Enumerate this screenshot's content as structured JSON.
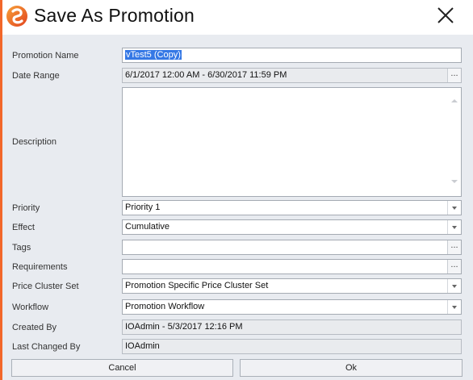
{
  "dialog": {
    "title": "Save As Promotion",
    "accent_color": "#f2672a"
  },
  "fields": {
    "promotion_name": {
      "label": "Promotion Name",
      "value": "vTest5 (Copy)"
    },
    "date_range": {
      "label": "Date Range",
      "value": "6/1/2017 12:00 AM - 6/30/2017 11:59 PM",
      "button": "..."
    },
    "description": {
      "label": "Description",
      "value": ""
    },
    "priority": {
      "label": "Priority",
      "value": "Priority 1"
    },
    "effect": {
      "label": "Effect",
      "value": "Cumulative"
    },
    "tags": {
      "label": "Tags",
      "value": "",
      "button": "..."
    },
    "requirements": {
      "label": "Requirements",
      "value": "",
      "button": "..."
    },
    "price_cluster_set": {
      "label": "Price Cluster Set",
      "value": "Promotion Specific Price Cluster Set"
    },
    "workflow": {
      "label": "Workflow",
      "value": "Promotion Workflow"
    },
    "created_by": {
      "label": "Created By",
      "value": "IOAdmin - 5/3/2017 12:16 PM"
    },
    "last_changed_by": {
      "label": "Last Changed By",
      "value": "IOAdmin"
    }
  },
  "buttons": {
    "cancel": "Cancel",
    "ok": "Ok"
  },
  "icons": {
    "logo": "app-logo-icon",
    "close": "close-icon",
    "ellipsis": "ellipsis-icon",
    "dropdown": "chevron-down-icon"
  }
}
